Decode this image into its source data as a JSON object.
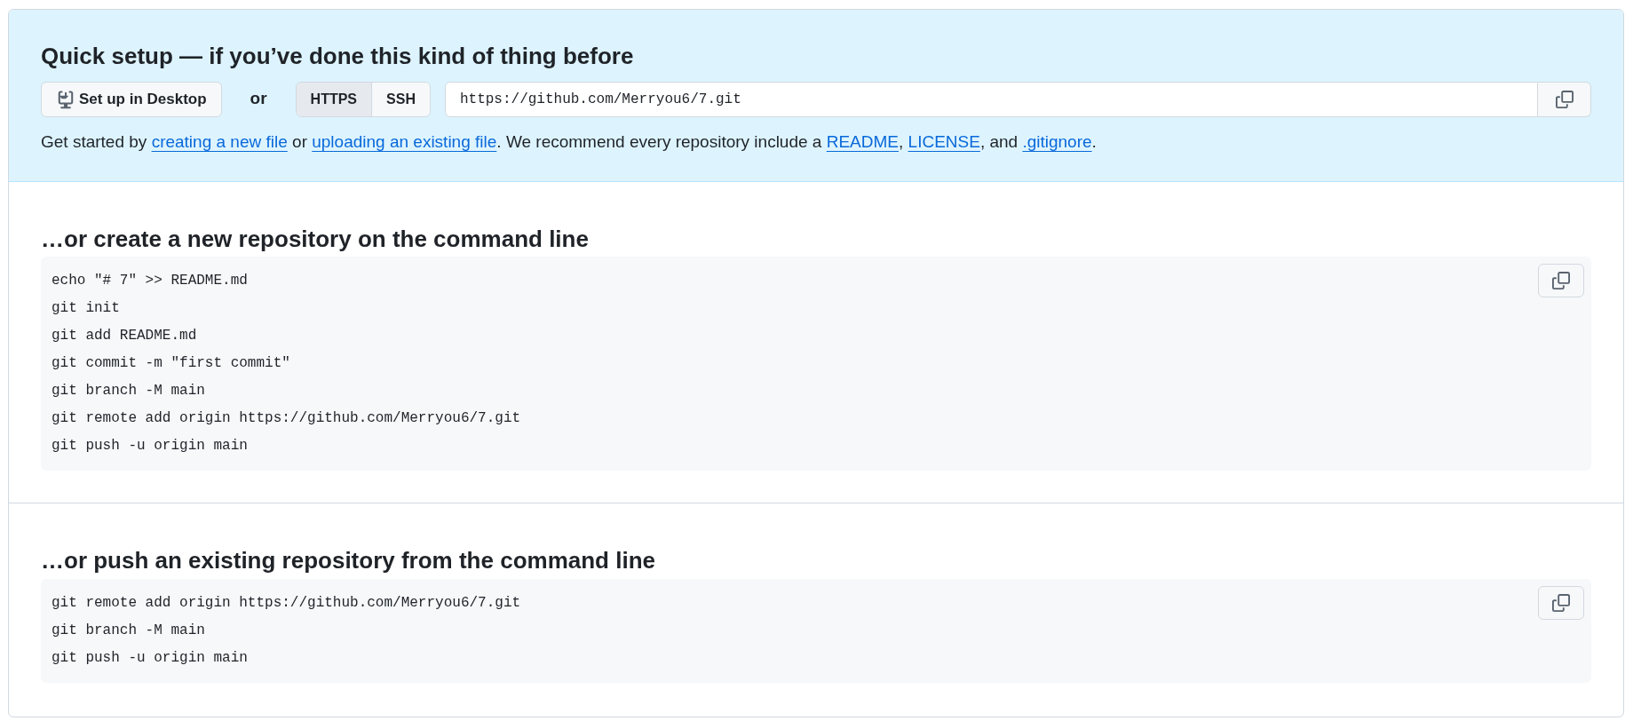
{
  "quick_setup": {
    "title": "Quick setup — if you’ve done this kind of thing before",
    "desktop_button": "Set up in Desktop",
    "or_label": "or",
    "protocol_tabs": [
      {
        "label": "HTTPS",
        "selected": true
      },
      {
        "label": "SSH",
        "selected": false
      }
    ],
    "url_field": {
      "value": "https://github.com/Merryou6/7.git"
    },
    "instructions": [
      {
        "kind": "text",
        "text": "Get started by "
      },
      {
        "kind": "link",
        "text": "creating a new file"
      },
      {
        "kind": "text",
        "text": " or "
      },
      {
        "kind": "link",
        "text": "uploading an existing file"
      },
      {
        "kind": "text",
        "text": ". We recommend every repository include a "
      },
      {
        "kind": "link",
        "text": "README"
      },
      {
        "kind": "text",
        "text": ", "
      },
      {
        "kind": "link",
        "text": "LICENSE"
      },
      {
        "kind": "text",
        "text": ", and "
      },
      {
        "kind": "link",
        "text": ".gitignore"
      },
      {
        "kind": "text",
        "text": "."
      }
    ]
  },
  "sections": [
    {
      "heading": "…or create a new repository on the command line",
      "code_lines": [
        "echo \"# 7\" >> README.md",
        "git init",
        "git add README.md",
        "git commit -m \"first commit\"",
        "git branch -M main",
        "git remote add origin https://github.com/Merryou6/7.git",
        "git push -u origin main"
      ]
    },
    {
      "heading": "…or push an existing repository from the command line",
      "code_lines": [
        "git remote add origin https://github.com/Merryou6/7.git",
        "git branch -M main",
        "git push -u origin main"
      ]
    }
  ]
}
